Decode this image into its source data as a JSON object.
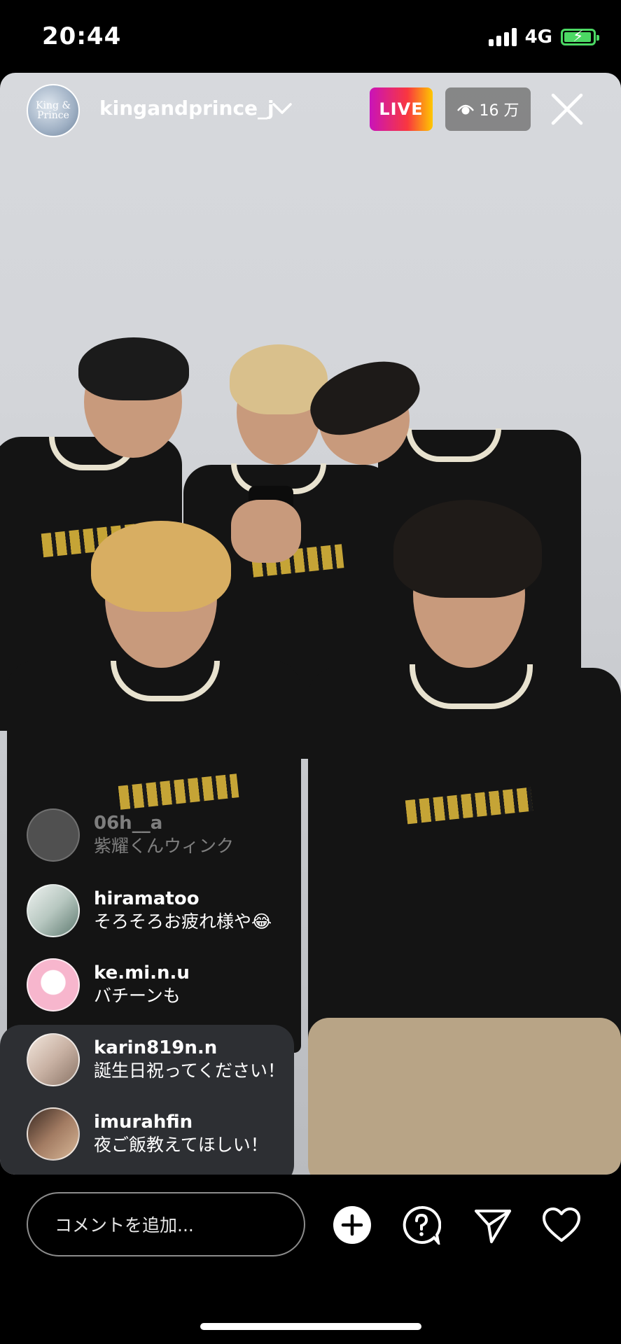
{
  "status_bar": {
    "time": "20:44",
    "network": "4G"
  },
  "broadcaster": {
    "username": "kingandprince_j",
    "avatar_text": "King & Prince"
  },
  "badges": {
    "live": "LIVE",
    "viewers": "16 万"
  },
  "comments": [
    {
      "user": "06h__a",
      "message": "紫耀くんウィンク",
      "faded": true
    },
    {
      "user": "hiramatoo",
      "message": "そろそろお疲れ様や😂",
      "faded": false
    },
    {
      "user": "ke.mi.n.u",
      "message": "バチーンも",
      "faded": false
    },
    {
      "user": "karin819n.n",
      "message": "誕生日祝ってください！",
      "faded": false
    },
    {
      "user": "imurahfin",
      "message": "夜ご飯教えてほしい！",
      "faded": false
    }
  ],
  "comment_bar": {
    "placeholder": "コメントを追加..."
  },
  "icons": [
    "add-icon",
    "question-icon",
    "send-icon",
    "heart-icon",
    "close-icon",
    "chevron-down-icon",
    "eye-icon"
  ],
  "colors": {
    "live_gradient": [
      "#c913b9",
      "#f9373f",
      "#fec700"
    ],
    "battery": "#4cd964"
  }
}
